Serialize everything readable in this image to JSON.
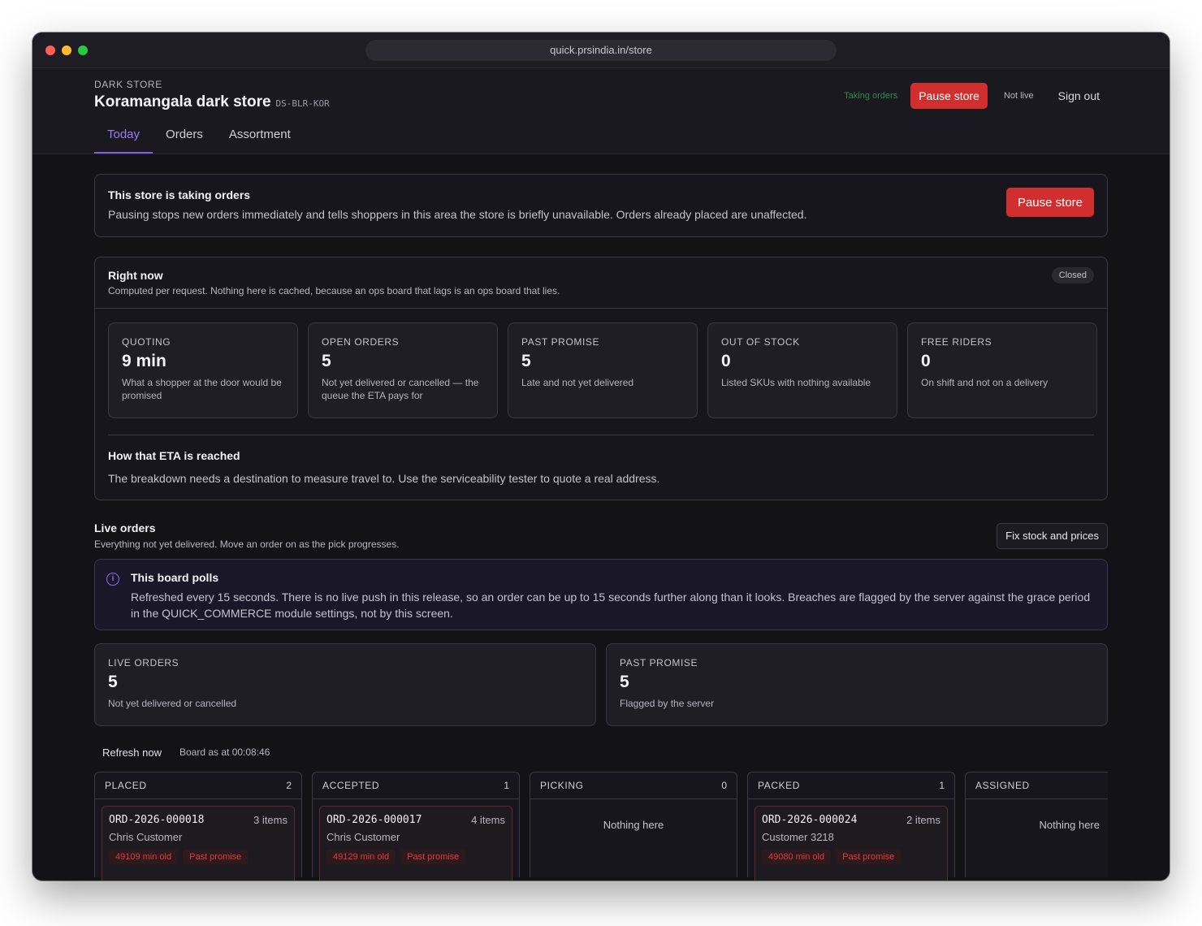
{
  "browser": {
    "url": "quick.prsindia.in/store"
  },
  "header": {
    "kicker": "DARK STORE",
    "store_name": "Koramangala dark store",
    "store_code": "DS-BLR-KOR",
    "status_taking": "Taking orders",
    "pause_label": "Pause store",
    "live_status": "Not live",
    "sign_out": "Sign out"
  },
  "tabs": [
    {
      "label": "Today",
      "active": true
    },
    {
      "label": "Orders",
      "active": false
    },
    {
      "label": "Assortment",
      "active": false
    }
  ],
  "taking_card": {
    "title": "This store is taking orders",
    "description": "Pausing stops new orders immediately and tells shoppers in this area the store is briefly unavailable. Orders already placed are unaffected.",
    "button": "Pause store"
  },
  "right_now": {
    "title": "Right now",
    "subtitle": "Computed per request. Nothing here is cached, because an ops board that lags is an ops board that lies.",
    "badge": "Closed",
    "stats": [
      {
        "label": "QUOTING",
        "value": "9 min",
        "desc": "What a shopper at the door would be promised"
      },
      {
        "label": "OPEN ORDERS",
        "value": "5",
        "desc": "Not yet delivered or cancelled — the queue the ETA pays for"
      },
      {
        "label": "PAST PROMISE",
        "value": "5",
        "desc": "Late and not yet delivered"
      },
      {
        "label": "OUT OF STOCK",
        "value": "0",
        "desc": "Listed SKUs with nothing available"
      },
      {
        "label": "FREE RIDERS",
        "value": "0",
        "desc": "On shift and not on a delivery"
      }
    ],
    "eta_title": "How that ETA is reached",
    "eta_desc": "The breakdown needs a destination to measure travel to. Use the serviceability tester to quote a real address."
  },
  "live_orders": {
    "title": "Live orders",
    "subtitle": "Everything not yet delivered. Move an order on as the pick progresses.",
    "fix_button": "Fix stock and prices",
    "polls_title": "This board polls",
    "polls_desc": "Refreshed every 15 seconds. There is no live push in this release, so an order can be up to 15 seconds further along than it looks. Breaches are flagged by the server against the grace period in the QUICK_COMMERCE module settings, not by this screen.",
    "big_stats": [
      {
        "label": "LIVE ORDERS",
        "value": "5",
        "desc": "Not yet delivered or cancelled"
      },
      {
        "label": "PAST PROMISE",
        "value": "5",
        "desc": "Flagged by the server"
      }
    ],
    "refresh_label": "Refresh now",
    "board_as_at": "Board as at 00:08:46"
  },
  "kanban": {
    "empty_text": "Nothing here",
    "columns": [
      {
        "name": "PLACED",
        "count": "2",
        "order": {
          "id": "ORD-2026-000018",
          "items": "3 items",
          "customer": "Chris Customer",
          "age": "49109 min old",
          "flag": "Past promise"
        }
      },
      {
        "name": "ACCEPTED",
        "count": "1",
        "order": {
          "id": "ORD-2026-000017",
          "items": "4 items",
          "customer": "Chris Customer",
          "age": "49129 min old",
          "flag": "Past promise"
        }
      },
      {
        "name": "PICKING",
        "count": "0"
      },
      {
        "name": "PACKED",
        "count": "1",
        "order": {
          "id": "ORD-2026-000024",
          "items": "2 items",
          "customer": "Customer 3218",
          "age": "49080 min old",
          "flag": "Past promise"
        }
      },
      {
        "name": "ASSIGNED"
      }
    ]
  },
  "colors": {
    "accent": "#7c5ce6",
    "danger": "#d12e2e",
    "success": "#2f8a4a",
    "background": "#131217"
  }
}
